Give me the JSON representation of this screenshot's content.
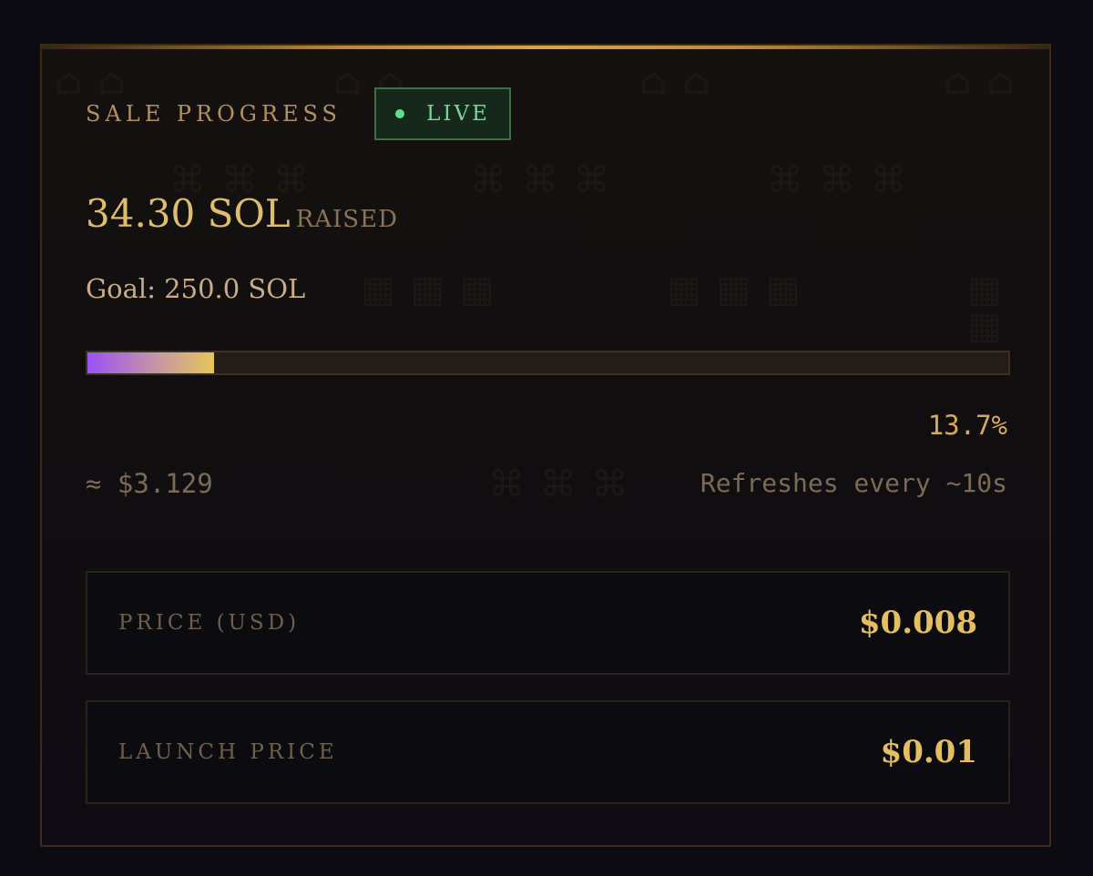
{
  "sale": {
    "title": "SALE PROGRESS",
    "status": "LIVE",
    "raised_amount": "34.30 SOL",
    "raised_suffix": "RAISED",
    "goal": "Goal: 250.0 SOL",
    "progress_fraction": 0.137,
    "percent_label": "13.7%",
    "usd_approx": "≈ $3.129",
    "refresh_note": "Refreshes every ~10s"
  },
  "prices": [
    {
      "label": "PRICE (USD)",
      "value": "$0.008"
    },
    {
      "label": "LAUNCH PRICE",
      "value": "$0.01"
    }
  ],
  "colors": {
    "accent_gold": "#e0bd6c",
    "live_green": "#5ee08a",
    "progress_start": "#9a52f2",
    "progress_end": "#e7c55a",
    "background": "#0c0b12"
  },
  "icons": {
    "live_indicator": "status-dot-icon"
  }
}
